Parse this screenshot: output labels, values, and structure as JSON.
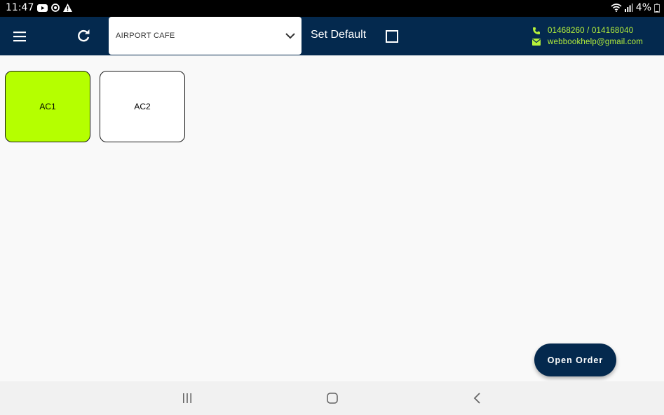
{
  "status_bar": {
    "time": "11:47",
    "battery": "4%",
    "left_icons": [
      "youtube-icon",
      "sync-icon",
      "warning-icon"
    ],
    "right_icons": [
      "wifi-icon",
      "signal-icon",
      "battery-icon"
    ]
  },
  "app_bar": {
    "bg_color": "#04294e",
    "outlet_value": "AIRPORT CAFE",
    "set_default_label": "Set Default",
    "set_default_checked": false,
    "phone": "01468260 / 014168040",
    "email": "webbookhelp@gmail.com",
    "contact_color": "#b7f23a"
  },
  "tables": [
    {
      "label": "AC1",
      "color": "#b5ff00",
      "selected": true
    },
    {
      "label": "AC2",
      "color": "#ffffff",
      "selected": false
    }
  ],
  "fab": {
    "label": "Open Order"
  },
  "nav_bar": {
    "buttons": [
      "recents-icon",
      "home-icon",
      "back-icon"
    ]
  }
}
